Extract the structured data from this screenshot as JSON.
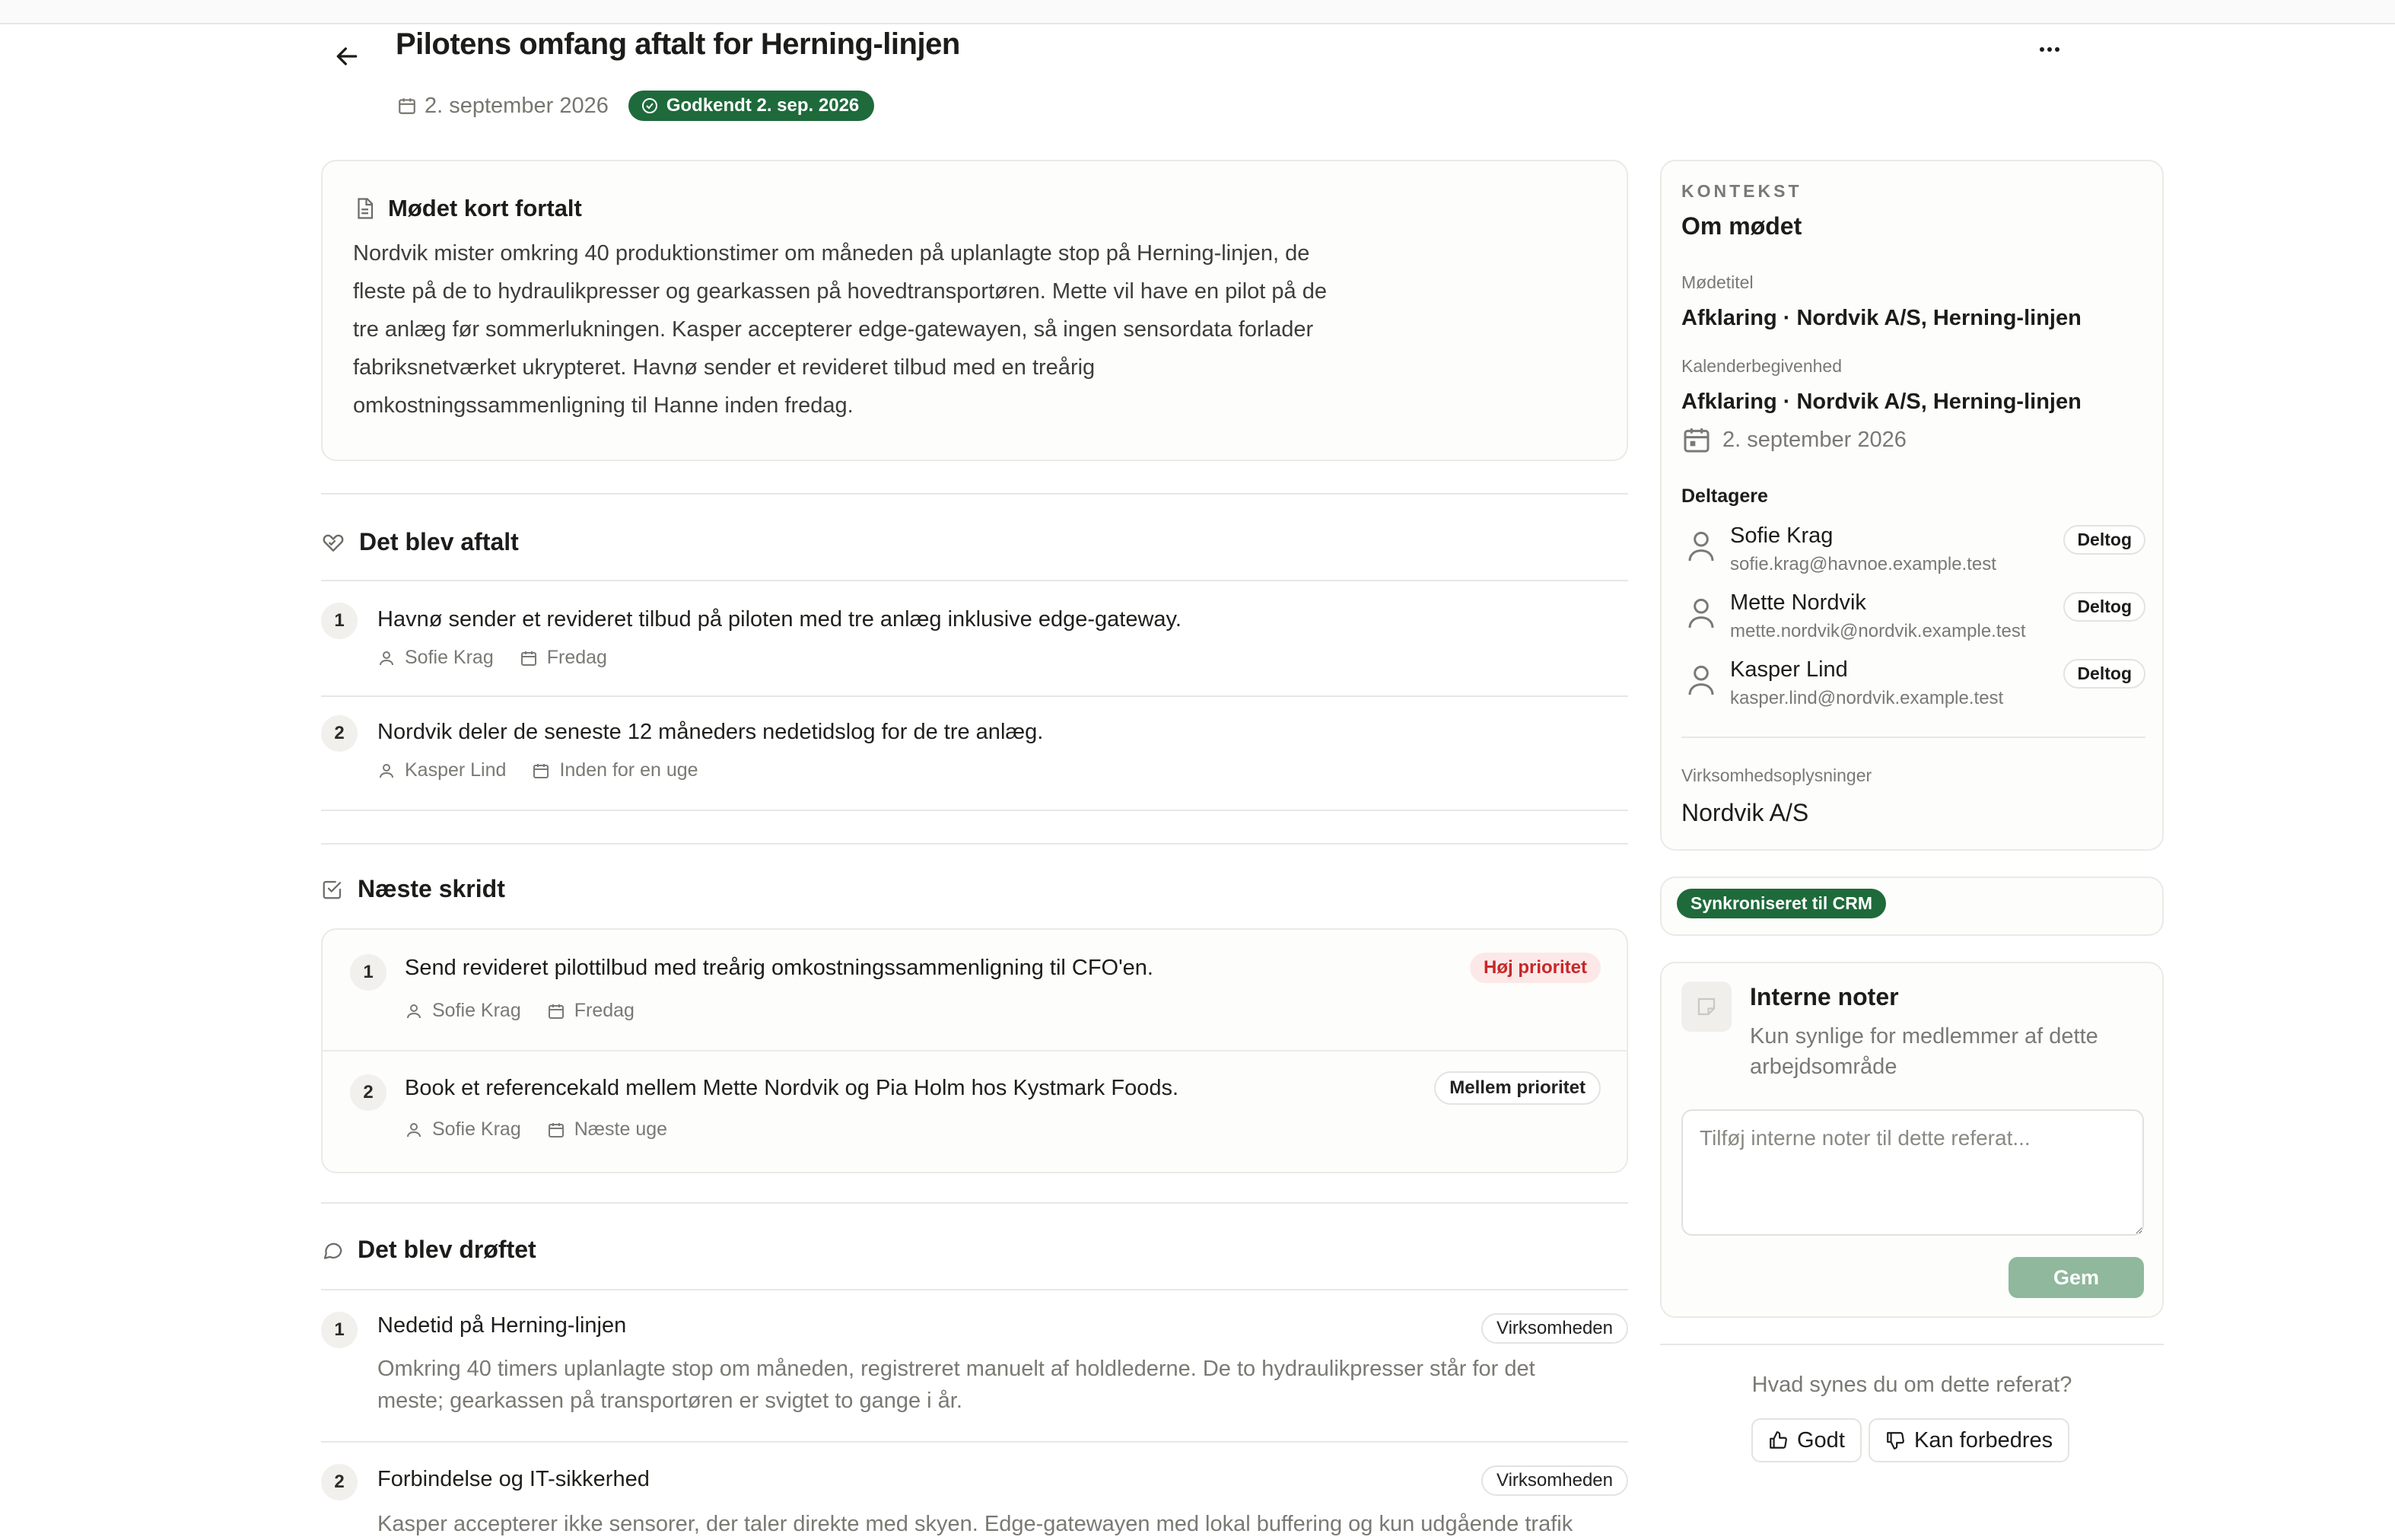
{
  "header": {
    "title": "Pilotens omfang aftalt for Herning-linjen",
    "date": "2. september 2026",
    "approved_badge": "Godkendt 2. sep. 2026"
  },
  "summary": {
    "title": "Mødet kort fortalt",
    "text": "Nordvik mister omkring 40 produktionstimer om måneden på uplanlagte stop på Herning-linjen, de fleste på de to hydraulikpresser og gearkassen på hovedtransportøren. Mette vil have en pilot på de tre anlæg før sommerlukningen. Kasper accepterer edge-gatewayen, så ingen sensordata forlader fabriksnetværket ukrypteret. Havnø sender et revideret tilbud med en treårig omkostningssammenligning til Hanne inden fredag."
  },
  "agreed": {
    "title": "Det blev aftalt",
    "items": [
      {
        "num": "1",
        "text": "Havnø sender et revideret tilbud på piloten med tre anlæg inklusive edge-gateway.",
        "owner": "Sofie Krag",
        "due": "Fredag"
      },
      {
        "num": "2",
        "text": "Nordvik deler de seneste 12 måneders nedetidslog for de tre anlæg.",
        "owner": "Kasper Lind",
        "due": "Inden for en uge"
      }
    ]
  },
  "next_steps": {
    "title": "Næste skridt",
    "items": [
      {
        "num": "1",
        "text": "Send revideret pilottilbud med treårig omkostningssammenligning til CFO'en.",
        "owner": "Sofie Krag",
        "due": "Fredag",
        "priority": "Høj prioritet"
      },
      {
        "num": "2",
        "text": "Book et referencekald mellem Mette Nordvik og Pia Holm hos Kystmark Foods.",
        "owner": "Sofie Krag",
        "due": "Næste uge",
        "priority": "Mellem prioritet"
      }
    ]
  },
  "discussed": {
    "title": "Det blev drøftet",
    "items": [
      {
        "num": "1",
        "title": "Nedetid på Herning-linjen",
        "tag": "Virksomheden",
        "text": "Omkring 40 timers uplanlagte stop om måneden, registreret manuelt af holdlederne. De to hydraulikpresser står for det meste; gearkassen på transportøren er svigtet to gange i år."
      },
      {
        "num": "2",
        "title": "Forbindelse og IT-sikkerhed",
        "tag": "Virksomheden",
        "text": "Kasper accepterer ikke sensorer, der taler direkte med skyen. Edge-gatewayen med lokal buffering og kun udgående trafik"
      }
    ]
  },
  "context": {
    "kicker": "KONTEKST",
    "title": "Om mødet",
    "meeting_title_label": "Mødetitel",
    "meeting_title": "Afklaring · Nordvik A/S, Herning-linjen",
    "calendar_label": "Kalenderbegivenhed",
    "calendar_title": "Afklaring · Nordvik A/S, Herning-linjen",
    "calendar_date": "2. september 2026",
    "participants_label": "Deltagere",
    "participants": [
      {
        "name": "Sofie Krag",
        "email": "sofie.krag@havnoe.example.test",
        "status": "Deltog"
      },
      {
        "name": "Mette Nordvik",
        "email": "mette.nordvik@nordvik.example.test",
        "status": "Deltog"
      },
      {
        "name": "Kasper Lind",
        "email": "kasper.lind@nordvik.example.test",
        "status": "Deltog"
      }
    ],
    "company_label": "Virksomhedsoplysninger",
    "company": "Nordvik A/S"
  },
  "crm": {
    "badge": "Synkroniseret til CRM"
  },
  "notes": {
    "title": "Interne noter",
    "subtitle": "Kun synlige for medlemmer af dette arbejdsområde",
    "placeholder": "Tilføj interne noter til dette referat...",
    "save": "Gem"
  },
  "feedback": {
    "question": "Hvad synes du om dette referat?",
    "good": "Godt",
    "improve": "Kan forbedres"
  },
  "colors": {
    "accent_green": "#1e6a3b",
    "high_priority": "#c62828",
    "save_button": "#8fb89c"
  }
}
